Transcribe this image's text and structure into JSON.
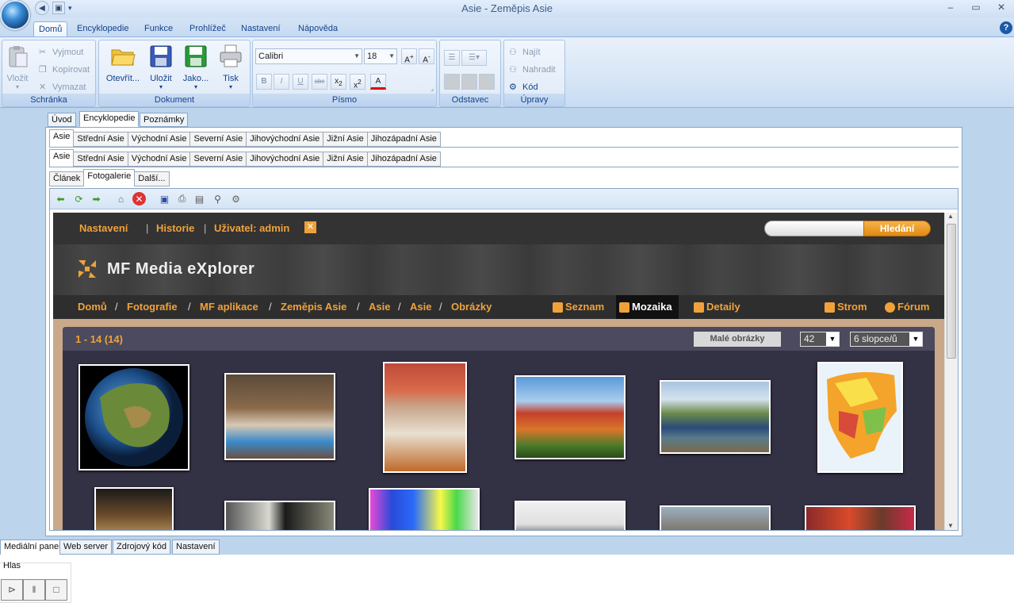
{
  "window": {
    "title": "Asie - Zeměpis Asie",
    "controls": {
      "minimize": "‒",
      "maximize": "▭",
      "close": "✕"
    }
  },
  "ribbon_tabs": [
    "Domů",
    "Encyklopedie",
    "Funkce",
    "Prohlížeč",
    "Nastavení",
    "Nápověda"
  ],
  "ribbon": {
    "clipboard": {
      "label": "Schránka",
      "paste": "Vložit",
      "cut": "Vyjmout",
      "copy": "Kopírovat",
      "delete": "Vymazat"
    },
    "document": {
      "label": "Dokument",
      "open": "Otevřít...",
      "save": "Uložit",
      "save_as": "Jako...",
      "print": "Tisk"
    },
    "font": {
      "label": "Písmo",
      "family": "Calibri",
      "size": "18"
    },
    "paragraph": {
      "label": "Odstavec"
    },
    "edit": {
      "label": "Úpravy",
      "find": "Najít",
      "replace": "Nahradit",
      "code": "Kód"
    }
  },
  "outer_tabs": [
    "Úvod",
    "Encyklopedie",
    "Poznámky"
  ],
  "region_tabs": [
    "Asie",
    "Střední Asie",
    "Východní Asie",
    "Severní Asie",
    "Jihovýchodní Asie",
    "Jižní Asie",
    "Jihozápadní Asie"
  ],
  "region_tabs2": [
    "Asie",
    "Střední Asie",
    "Východní Asie",
    "Severní Asie",
    "Jihovýchodní Asie",
    "Jižní Asie",
    "Jihozápadní Asie"
  ],
  "content_tabs": [
    "Článek",
    "Fotogalerie",
    "Další..."
  ],
  "webpage": {
    "top_links": {
      "settings": "Nastavení",
      "history": "Historie",
      "user": "Uživatel: admin"
    },
    "search_button": "Hledání",
    "logo_text": "MF Media eXplorer",
    "breadcrumb": [
      "Domů",
      "Fotografie",
      "MF aplikace",
      "Zeměpis Asie",
      "Asie",
      "Asie",
      "Obrázky"
    ],
    "views": {
      "list": "Seznam",
      "mosaic": "Mozaika",
      "details": "Detaily",
      "tree": "Strom",
      "forum": "Fórum"
    },
    "gallery": {
      "count": "1 - 14 (14)",
      "small_images": "Malé obrázky",
      "per_page": "42",
      "columns": "6 slopce/ů"
    }
  },
  "bottom_tabs": [
    "Mediální panel",
    "Web server",
    "Zdrojový kód",
    "Nastavení"
  ],
  "bottom_panel": {
    "label": "Hlas"
  },
  "colors": {
    "accent": "#f0a23a",
    "ribbon_text": "#15428b"
  }
}
